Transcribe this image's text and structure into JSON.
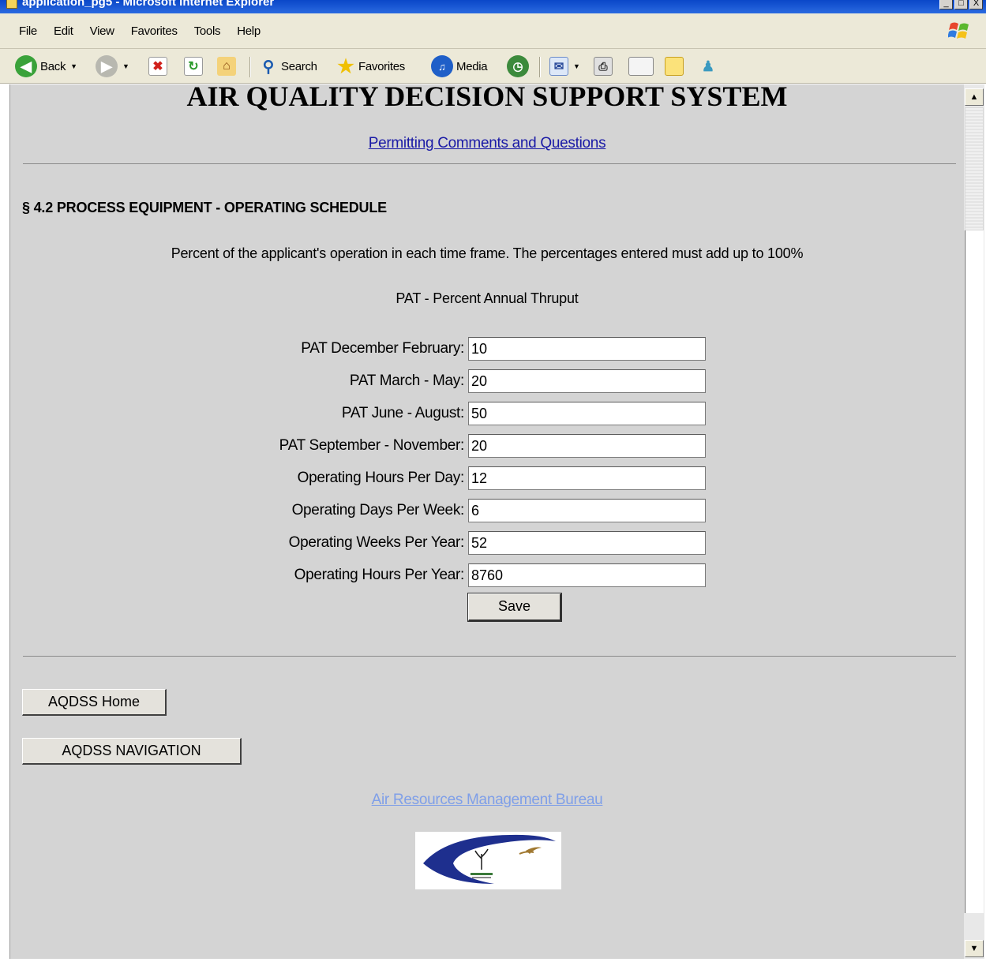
{
  "window": {
    "title": "application_pg5 - Microsoft Internet Explorer",
    "min_label": "_",
    "max_label": "□",
    "close_label": "X"
  },
  "menu": [
    "File",
    "Edit",
    "View",
    "Favorites",
    "Tools",
    "Help"
  ],
  "toolbar": {
    "back_label": "Back",
    "search_label": "Search",
    "favorites_label": "Favorites",
    "media_label": "Media"
  },
  "page": {
    "app_title": "AIR QUALITY DECISION SUPPORT SYSTEM",
    "comments_link": "Permitting Comments and Questions",
    "section_heading": "§  4.2 PROCESS EQUIPMENT - OPERATING SCHEDULE",
    "instructions": "Percent of the applicant's operation in each time frame. The percentages entered must add up to 100%",
    "pat_note": "PAT - Percent Annual Thruput",
    "fields": [
      {
        "label": "PAT December   February:",
        "value": "10"
      },
      {
        "label": "PAT March - May:",
        "value": "20"
      },
      {
        "label": "PAT June - August:",
        "value": "50"
      },
      {
        "label": "PAT September - November:",
        "value": "20"
      },
      {
        "label": "Operating Hours Per Day:",
        "value": "12"
      },
      {
        "label": "Operating Days Per Week:",
        "value": "6"
      },
      {
        "label": "Operating Weeks Per Year:",
        "value": "52"
      },
      {
        "label": "Operating Hours Per Year:",
        "value": "8760"
      }
    ],
    "save_label": "Save",
    "home_button": "AQDSS Home",
    "navigation_button": "AQDSS NAVIGATION",
    "bureau_link": "Air Resources Management Bureau"
  },
  "colors": {
    "page_background": "#d4d4d4",
    "link": "#1a1aa6",
    "visited_link": "#7f9fe8",
    "chrome": "#ece9d8"
  }
}
